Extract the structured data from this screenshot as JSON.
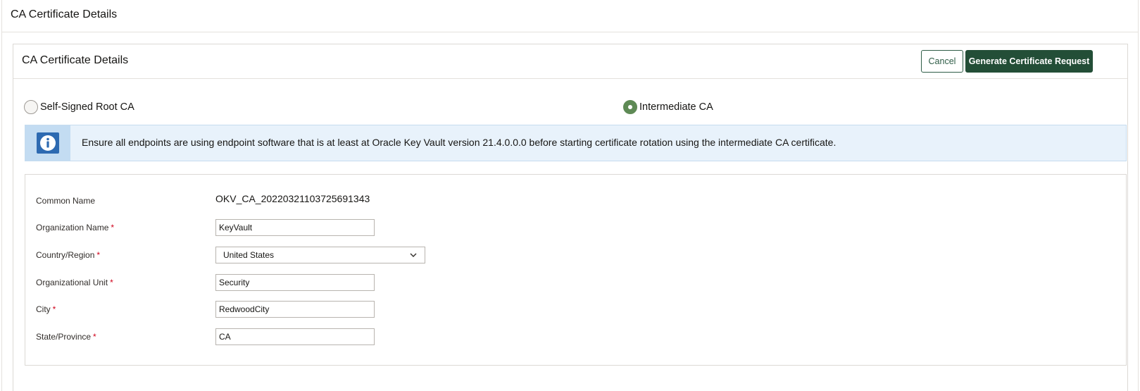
{
  "page": {
    "title": "CA Certificate Details"
  },
  "region": {
    "title": "CA Certificate Details",
    "cancel_label": "Cancel",
    "generate_label": "Generate Certificate Request"
  },
  "ca_type": {
    "options": [
      {
        "label": "Self-Signed Root CA",
        "selected": false
      },
      {
        "label": "Intermediate CA",
        "selected": true
      }
    ]
  },
  "info": {
    "message": "Ensure all endpoints are using endpoint software that is at least at Oracle Key Vault version 21.4.0.0.0 before starting certificate rotation using the intermediate CA certificate."
  },
  "form": {
    "common_name": {
      "label": "Common Name",
      "value": "OKV_CA_20220321103725691343"
    },
    "organization_name": {
      "label": "Organization Name",
      "value": "KeyVault",
      "required_mark": "*"
    },
    "country_region": {
      "label": "Country/Region",
      "value": "United States",
      "required_mark": "*"
    },
    "organizational_unit": {
      "label": "Organizational Unit",
      "value": "Security",
      "required_mark": "*"
    },
    "city": {
      "label": "City",
      "value": "RedwoodCity",
      "required_mark": "*"
    },
    "state_province": {
      "label": "State/Province",
      "value": "CA",
      "required_mark": "*"
    }
  },
  "colors": {
    "primary_button": "#234e37",
    "radio_selected": "#5e8a55",
    "info_icon": "#2d6ab1",
    "info_background": "#e8f2fb",
    "required": "#d0021b"
  }
}
